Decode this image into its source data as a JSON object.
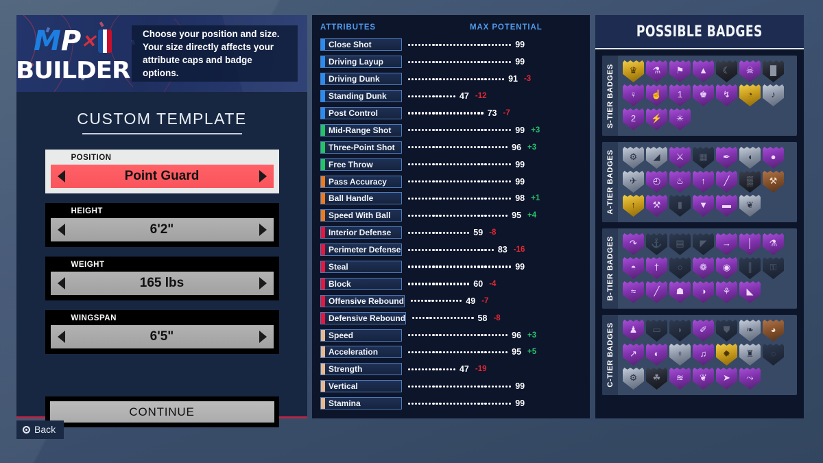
{
  "brand": {
    "logo_mp_m": "M",
    "logo_mp_p": "P",
    "logo_x": "✕",
    "logo_builder": "BUILDER",
    "logo_nba_name": "nba-logo",
    "hint": "Choose your position and size. Your size directly affects your attribute caps and badge options."
  },
  "left": {
    "section_title": "CUSTOM TEMPLATE",
    "selectors": [
      {
        "label": "POSITION",
        "value": "Point Guard",
        "highlighted": true
      },
      {
        "label": "HEIGHT",
        "value": "6'2\"",
        "highlighted": false
      },
      {
        "label": "WEIGHT",
        "value": "165 lbs",
        "highlighted": false
      },
      {
        "label": "WINGSPAN",
        "value": "6'5\"",
        "highlighted": false
      }
    ],
    "continue_label": "CONTINUE",
    "back_label": "Back"
  },
  "attributes_panel": {
    "header_left": "ATTRIBUTES",
    "header_right": "MAX POTENTIAL",
    "category_colors": {
      "finishing": "#2a8cf0",
      "shooting": "#22c55e",
      "playmaking": "#ef7a1a",
      "defense": "#e5173f",
      "physicals": "#e8b98f"
    },
    "rows": [
      {
        "name": "Close Shot",
        "category": "finishing",
        "value": 99,
        "delta": null
      },
      {
        "name": "Driving Layup",
        "category": "finishing",
        "value": 99,
        "delta": null
      },
      {
        "name": "Driving Dunk",
        "category": "finishing",
        "value": 91,
        "delta": -3
      },
      {
        "name": "Standing Dunk",
        "category": "finishing",
        "value": 47,
        "delta": -12
      },
      {
        "name": "Post Control",
        "category": "finishing",
        "value": 73,
        "delta": -7
      },
      {
        "name": "Mid-Range Shot",
        "category": "shooting",
        "value": 99,
        "delta": 3
      },
      {
        "name": "Three-Point Shot",
        "category": "shooting",
        "value": 96,
        "delta": 3
      },
      {
        "name": "Free Throw",
        "category": "shooting",
        "value": 99,
        "delta": null
      },
      {
        "name": "Pass Accuracy",
        "category": "playmaking",
        "value": 99,
        "delta": null
      },
      {
        "name": "Ball Handle",
        "category": "playmaking",
        "value": 98,
        "delta": 1
      },
      {
        "name": "Speed With Ball",
        "category": "playmaking",
        "value": 95,
        "delta": 4
      },
      {
        "name": "Interior Defense",
        "category": "defense",
        "value": 59,
        "delta": -8
      },
      {
        "name": "Perimeter Defense",
        "category": "defense",
        "value": 83,
        "delta": -16
      },
      {
        "name": "Steal",
        "category": "defense",
        "value": 99,
        "delta": null
      },
      {
        "name": "Block",
        "category": "defense",
        "value": 60,
        "delta": -4
      },
      {
        "name": "Offensive Rebound",
        "category": "defense",
        "value": 49,
        "delta": -7
      },
      {
        "name": "Defensive Rebound",
        "category": "defense",
        "value": 58,
        "delta": -8
      },
      {
        "name": "Speed",
        "category": "physicals",
        "value": 96,
        "delta": 3
      },
      {
        "name": "Acceleration",
        "category": "physicals",
        "value": 95,
        "delta": 5
      },
      {
        "name": "Strength",
        "category": "physicals",
        "value": 47,
        "delta": -19
      },
      {
        "name": "Vertical",
        "category": "physicals",
        "value": 99,
        "delta": null
      },
      {
        "name": "Stamina",
        "category": "physicals",
        "value": 99,
        "delta": null
      }
    ]
  },
  "badges_panel": {
    "title": "POSSIBLE BADGES",
    "tiers": [
      {
        "label": "S-TIER BADGES",
        "badges": [
          {
            "icon": "trophy-badge-icon",
            "style": "gold"
          },
          {
            "icon": "potion-badge-icon",
            "style": "purple"
          },
          {
            "icon": "needle-badge-icon",
            "style": "purple"
          },
          {
            "icon": "bat-badge-icon",
            "style": "purple"
          },
          {
            "icon": "moon-badge-icon",
            "style": "black"
          },
          {
            "icon": "skull-badge-icon",
            "style": "purple"
          },
          {
            "icon": "pillar-badge-icon",
            "style": "black"
          },
          {
            "icon": "figure-badge-icon",
            "style": "purple"
          },
          {
            "icon": "hand-badge-icon",
            "style": "purple"
          },
          {
            "icon": "one-badge-icon",
            "style": "purple"
          },
          {
            "icon": "crown-badge-icon",
            "style": "purple"
          },
          {
            "icon": "jumper-badge-icon",
            "style": "purple"
          },
          {
            "icon": "signal-badge-icon",
            "style": "gold"
          },
          {
            "icon": "horn-badge-icon",
            "style": "silver"
          },
          {
            "icon": "two-badge-icon",
            "style": "purple"
          },
          {
            "icon": "bolt-badge-icon",
            "style": "purple"
          },
          {
            "icon": "spark-badge-icon",
            "style": "purple"
          }
        ]
      },
      {
        "label": "A-TIER BADGES",
        "badges": [
          {
            "icon": "robot-badge-icon",
            "style": "silver"
          },
          {
            "icon": "boot-badge-icon",
            "style": "silver"
          },
          {
            "icon": "dancer-badge-icon",
            "style": "purple"
          },
          {
            "icon": "wall-badge-icon",
            "style": "dark"
          },
          {
            "icon": "broom-badge-icon",
            "style": "purple"
          },
          {
            "icon": "shell-badge-icon",
            "style": "silver"
          },
          {
            "icon": "ball-badge-icon",
            "style": "purple"
          },
          {
            "icon": "wings-badge-icon",
            "style": "silver"
          },
          {
            "icon": "clock-badge-icon",
            "style": "purple"
          },
          {
            "icon": "flame-badge-icon",
            "style": "purple"
          },
          {
            "icon": "arrow-badge-icon",
            "style": "purple"
          },
          {
            "icon": "blade-badge-icon",
            "style": "purple"
          },
          {
            "icon": "net-badge-icon",
            "style": "black"
          },
          {
            "icon": "hammer-badge-icon",
            "style": "bronze"
          },
          {
            "icon": "torch-badge-icon",
            "style": "gold"
          },
          {
            "icon": "pick-badge-icon",
            "style": "purple"
          },
          {
            "icon": "shadow-badge-icon",
            "style": "dark"
          },
          {
            "icon": "pin-badge-icon",
            "style": "purple"
          },
          {
            "icon": "bench-badge-icon",
            "style": "purple"
          },
          {
            "icon": "bird-badge-icon",
            "style": "silver"
          }
        ]
      },
      {
        "label": "B-TIER BADGES",
        "badges": [
          {
            "icon": "leg-badge-icon",
            "style": "purple"
          },
          {
            "icon": "anchor-badge-icon",
            "style": "dark"
          },
          {
            "icon": "brick-badge-icon",
            "style": "dark"
          },
          {
            "icon": "mountain-badge-icon",
            "style": "dark"
          },
          {
            "icon": "rabbit-badge-icon",
            "style": "purple"
          },
          {
            "icon": "post-badge-icon",
            "style": "purple"
          },
          {
            "icon": "flask-badge-icon",
            "style": "purple"
          },
          {
            "icon": "dome-badge-icon",
            "style": "purple"
          },
          {
            "icon": "torchb-badge-icon",
            "style": "purple"
          },
          {
            "icon": "orb-badge-icon",
            "style": "dark"
          },
          {
            "icon": "splash-badge-icon",
            "style": "purple"
          },
          {
            "icon": "eye-badge-icon",
            "style": "purple"
          },
          {
            "icon": "gate-badge-icon",
            "style": "dark"
          },
          {
            "icon": "lock-badge-icon",
            "style": "dark"
          },
          {
            "icon": "glide-badge-icon",
            "style": "purple"
          },
          {
            "icon": "sword-badge-icon",
            "style": "purple"
          },
          {
            "icon": "chest-badge-icon",
            "style": "purple"
          },
          {
            "icon": "globe-badge-icon",
            "style": "purple"
          },
          {
            "icon": "plant-badge-icon",
            "style": "purple"
          },
          {
            "icon": "shoe-badge-icon",
            "style": "purple"
          }
        ]
      },
      {
        "label": "C-TIER BADGES",
        "badges": [
          {
            "icon": "thrower-badge-icon",
            "style": "purple"
          },
          {
            "icon": "door-badge-icon",
            "style": "dark"
          },
          {
            "icon": "mask-badge-icon",
            "style": "dark"
          },
          {
            "icon": "brush-badge-icon",
            "style": "purple"
          },
          {
            "icon": "shield-badge-icon",
            "style": "dark"
          },
          {
            "icon": "feather-badge-icon",
            "style": "silver"
          },
          {
            "icon": "foot-badge-icon",
            "style": "bronze"
          },
          {
            "icon": "leap-badge-icon",
            "style": "purple"
          },
          {
            "icon": "whistle-badge-icon",
            "style": "purple"
          },
          {
            "icon": "mic-badge-icon",
            "style": "silver"
          },
          {
            "icon": "guitar-badge-icon",
            "style": "purple"
          },
          {
            "icon": "bee-badge-icon",
            "style": "gold"
          },
          {
            "icon": "statue-badge-icon",
            "style": "silver"
          },
          {
            "icon": "ghost-badge-icon",
            "style": "dark"
          },
          {
            "icon": "gear-badge-icon",
            "style": "silver"
          },
          {
            "icon": "clover-badge-icon",
            "style": "black"
          },
          {
            "icon": "wave-badge-icon",
            "style": "purple"
          },
          {
            "icon": "duck-badge-icon",
            "style": "purple"
          },
          {
            "icon": "dash-badge-icon",
            "style": "purple"
          },
          {
            "icon": "swipe-badge-icon",
            "style": "purple"
          }
        ]
      }
    ]
  }
}
